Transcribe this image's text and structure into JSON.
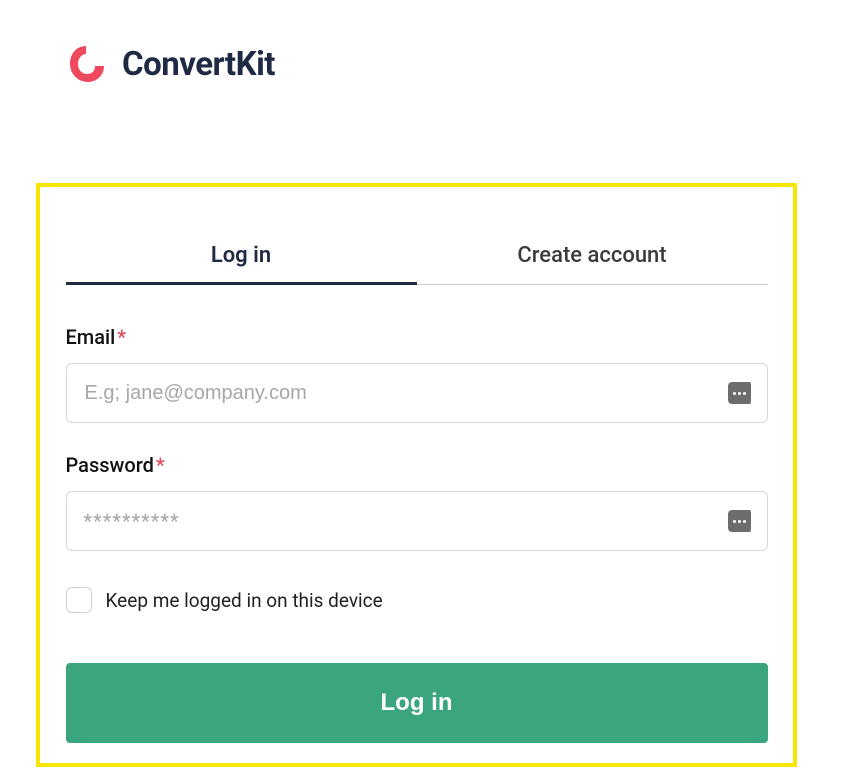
{
  "brand": {
    "name": "ConvertKit"
  },
  "tabs": {
    "login": "Log in",
    "create": "Create account"
  },
  "form": {
    "email_label": "Email",
    "email_placeholder": "E.g; jane@company.com",
    "password_label": "Password",
    "password_placeholder_mask": "**********",
    "required_mark": "*",
    "remember_label": "Keep me logged in on this device",
    "submit_label": "Log in"
  }
}
